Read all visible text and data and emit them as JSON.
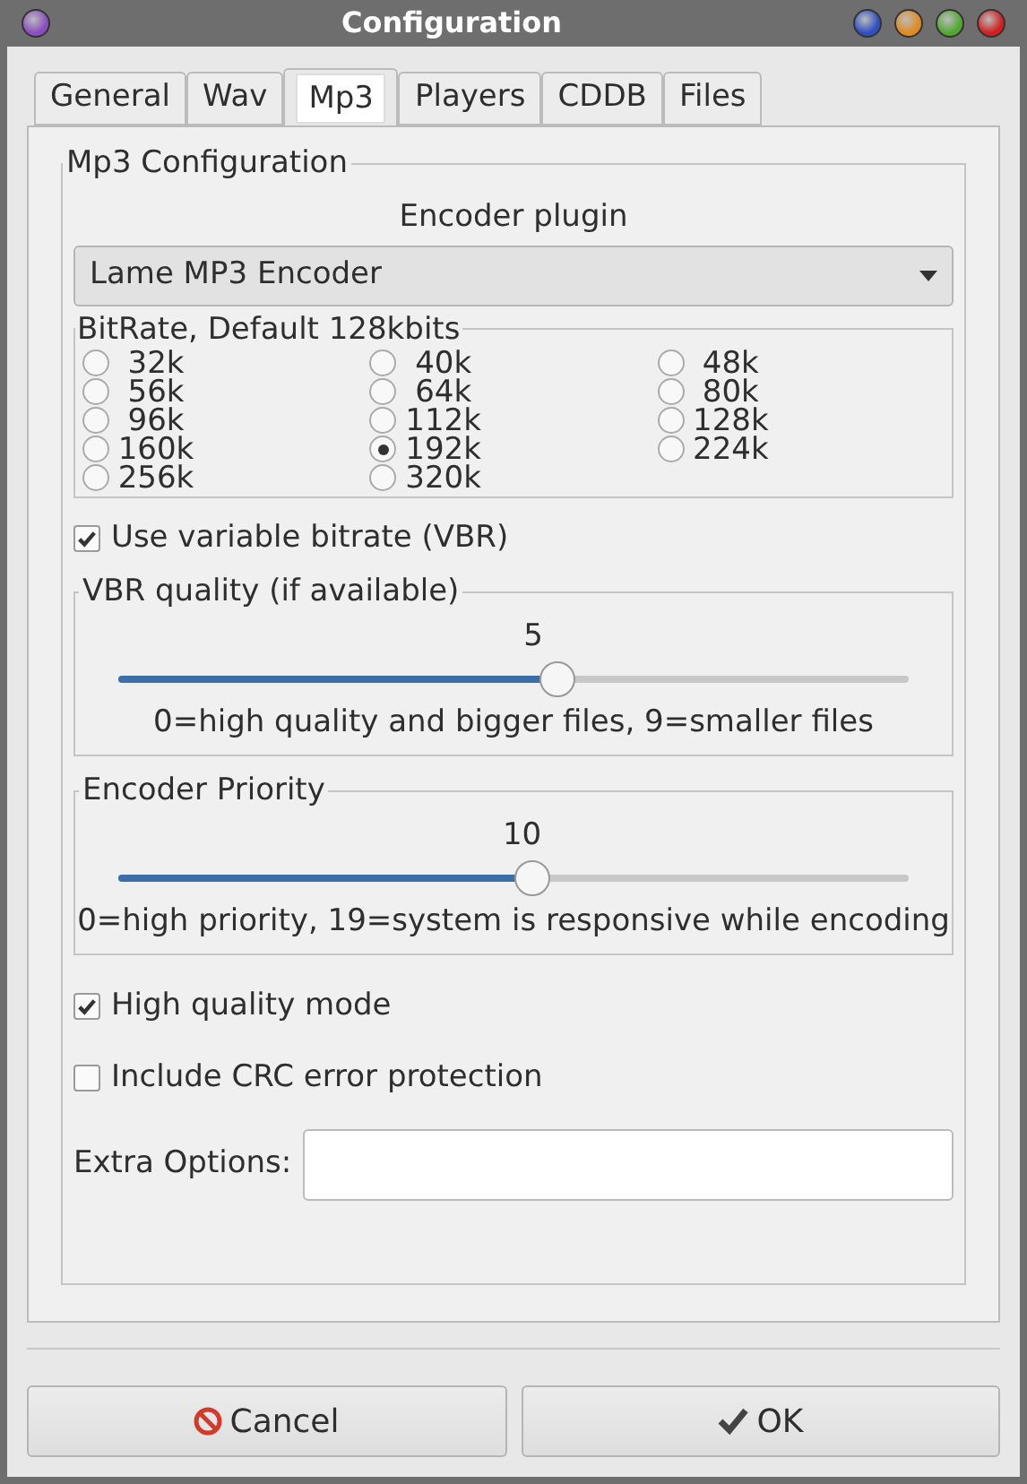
{
  "window": {
    "title": "Configuration"
  },
  "tabs": [
    {
      "label": "General",
      "selected": false
    },
    {
      "label": "Wav",
      "selected": false
    },
    {
      "label": "Mp3",
      "selected": true
    },
    {
      "label": "Players",
      "selected": false
    },
    {
      "label": "CDDB",
      "selected": false
    },
    {
      "label": "Files",
      "selected": false
    }
  ],
  "mp3_group": {
    "title": "Mp3 Configuration",
    "encoder_label": "Encoder plugin",
    "encoder_value": "Lame MP3 Encoder"
  },
  "bitrate": {
    "title": "BitRate, Default 128kbits",
    "options": [
      {
        "label": "32k",
        "selected": false
      },
      {
        "label": "40k",
        "selected": false
      },
      {
        "label": "48k",
        "selected": false
      },
      {
        "label": "56k",
        "selected": false
      },
      {
        "label": "64k",
        "selected": false
      },
      {
        "label": "80k",
        "selected": false
      },
      {
        "label": "96k",
        "selected": false
      },
      {
        "label": "112k",
        "selected": false
      },
      {
        "label": "128k",
        "selected": false
      },
      {
        "label": "160k",
        "selected": false
      },
      {
        "label": "192k",
        "selected": true
      },
      {
        "label": "224k",
        "selected": false
      },
      {
        "label": "256k",
        "selected": false
      },
      {
        "label": "320k",
        "selected": false
      }
    ]
  },
  "vbr": {
    "label": "Use variable bitrate (VBR)",
    "checked": true
  },
  "sliders": [
    {
      "title": "VBR quality (if available)",
      "reading": "5",
      "level": 0.555,
      "hint": "0=high quality and bigger files, 9=smaller files"
    },
    {
      "title": "Encoder Priority",
      "reading": "10",
      "level": 0.524,
      "hint": "0=high priority, 19=system is responsive while encoding"
    }
  ],
  "checkboxes": [
    {
      "label": "High quality mode",
      "checked": true
    },
    {
      "label": "Include CRC error protection",
      "checked": false
    }
  ],
  "extra_options": {
    "label": "Extra Options:"
  },
  "buttons": [
    {
      "label": "Cancel",
      "kind": "cancel"
    },
    {
      "label": "OK",
      "kind": "ok"
    }
  ]
}
